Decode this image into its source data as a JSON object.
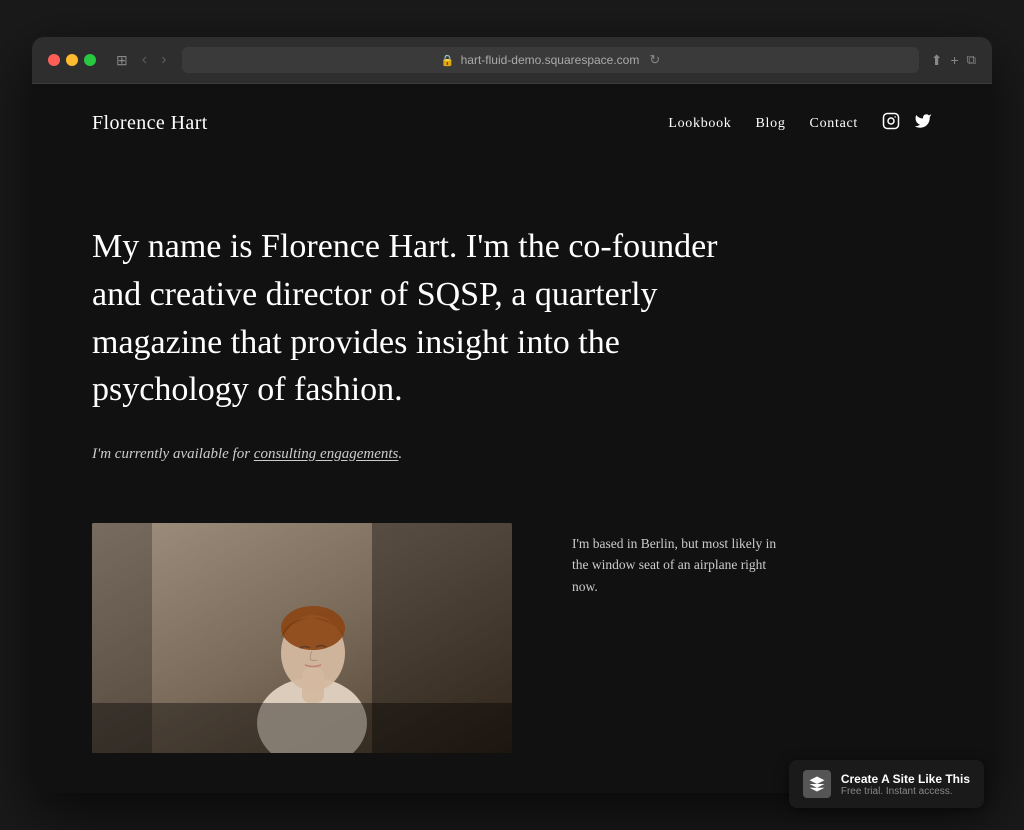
{
  "browser": {
    "url": "hart-fluid-demo.squarespace.com",
    "reload_icon": "↻",
    "back_icon": "‹",
    "forward_icon": "›",
    "share_icon": "⬆",
    "add_tab_icon": "+",
    "duplicate_icon": "⧉",
    "sidebar_icon": "⊞"
  },
  "site": {
    "logo": "Florence Hart",
    "nav": {
      "links": [
        "Lookbook",
        "Blog",
        "Contact"
      ]
    },
    "social": {
      "instagram_label": "Instagram",
      "twitter_label": "Twitter"
    },
    "hero": {
      "text": "My name is Florence Hart. I'm the co-founder and creative director of SQSP, a quarterly magazine that provides insight into the psychology of fashion."
    },
    "availability": {
      "prefix": "I'm currently available for ",
      "link_text": "consulting engagements",
      "suffix": "."
    },
    "location": {
      "text": "I'm based in Berlin, but most likely in the window seat of an airplane right now."
    }
  },
  "badge": {
    "title": "Create A Site Like This",
    "subtitle": "Free trial. Instant access."
  }
}
